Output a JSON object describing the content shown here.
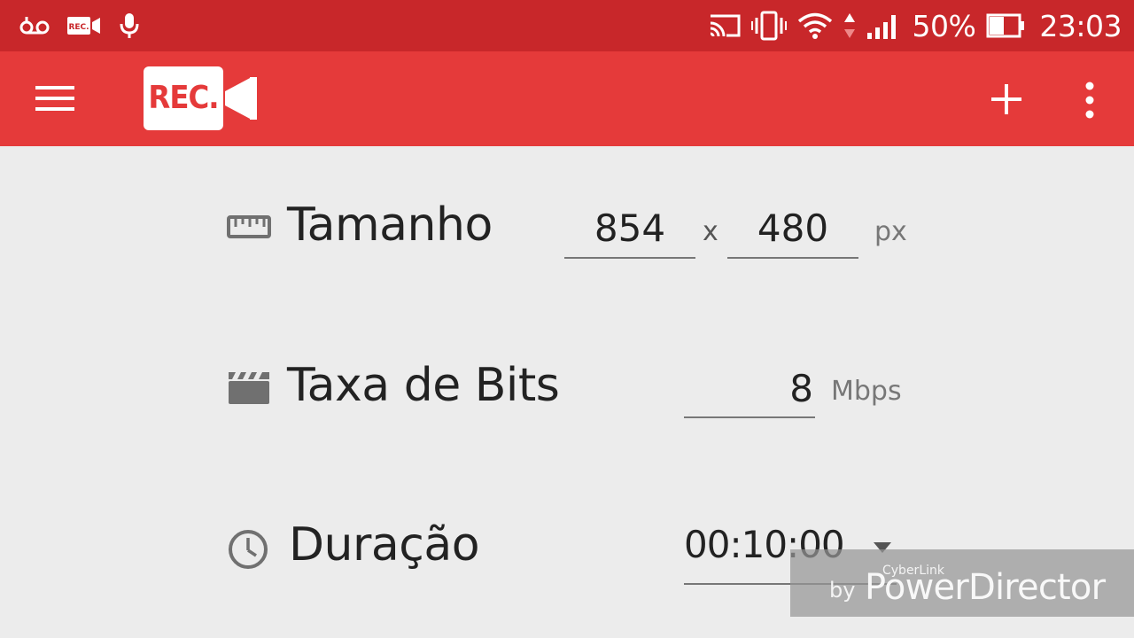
{
  "status_bar": {
    "battery_percent": "50%",
    "time": "23:03",
    "notification_icons": [
      "voicemail-icon",
      "rec-app-icon",
      "microphone-icon"
    ],
    "system_icons": [
      "cast-icon",
      "vibrate-icon",
      "wifi-icon",
      "data-arrows-icon",
      "signal-icon",
      "battery-icon"
    ],
    "battery_level": 0.5
  },
  "toolbar": {
    "app_logo_text": "REC.",
    "colors": {
      "toolbar": "#e53a3a",
      "status_bar": "#c8272a"
    },
    "actions": [
      "menu-icon",
      "add-icon",
      "more-vert-icon"
    ]
  },
  "settings": {
    "size": {
      "label": "Tamanho",
      "width": "854",
      "separator": "x",
      "height": "480",
      "unit": "px",
      "icon": "ruler-icon"
    },
    "bitrate": {
      "label": "Taxa de Bits",
      "value": "8",
      "unit": "Mbps",
      "icon": "clapperboard-icon"
    },
    "duration": {
      "label": "Duração",
      "value": "00:10:00",
      "icon": "clock-icon"
    }
  },
  "watermark": {
    "brand": "CyberLink",
    "by": "by",
    "product": "PowerDirector"
  }
}
